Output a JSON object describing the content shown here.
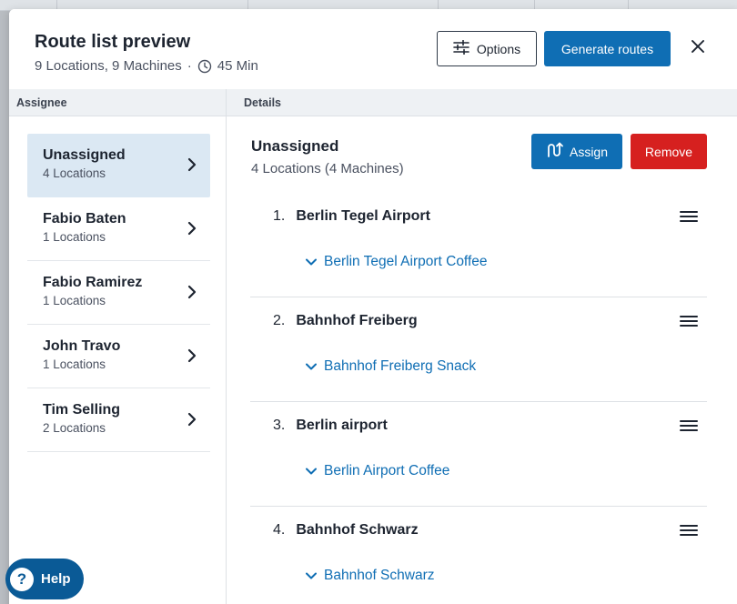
{
  "header": {
    "title": "Route list preview",
    "subtitle_locations": "9 Locations, 9 Machines",
    "subtitle_sep": "·",
    "subtitle_duration": "45 Min",
    "options_label": "Options",
    "generate_label": "Generate routes"
  },
  "columns": {
    "assignee": "Assignee",
    "details": "Details"
  },
  "assignees": [
    {
      "name": "Unassigned",
      "count": "4 Locations"
    },
    {
      "name": "Fabio Baten",
      "count": "1 Locations"
    },
    {
      "name": "Fabio Ramirez",
      "count": "1 Locations"
    },
    {
      "name": "John Travo",
      "count": "1 Locations"
    },
    {
      "name": "Tim Selling",
      "count": "2 Locations"
    }
  ],
  "details": {
    "title": "Unassigned",
    "subtitle": "4 Locations (4 Machines)",
    "assign_label": "Assign",
    "remove_label": "Remove",
    "routes": [
      {
        "num": "1.",
        "name": "Berlin Tegel Airport",
        "machine": "Berlin Tegel Airport Coffee"
      },
      {
        "num": "2.",
        "name": "Bahnhof Freiberg",
        "machine": "Bahnhof Freiberg Snack"
      },
      {
        "num": "3.",
        "name": "Berlin airport",
        "machine": "Berlin Airport Coffee"
      },
      {
        "num": "4.",
        "name": "Bahnhof Schwarz",
        "machine": "Bahnhof Schwarz"
      }
    ]
  },
  "help": {
    "label": "Help",
    "glyph": "?"
  },
  "colors": {
    "primary": "#0f6eb4",
    "danger": "#d6201f",
    "selected_bg": "#dbe8f3",
    "help_bg": "#0a5a96"
  }
}
